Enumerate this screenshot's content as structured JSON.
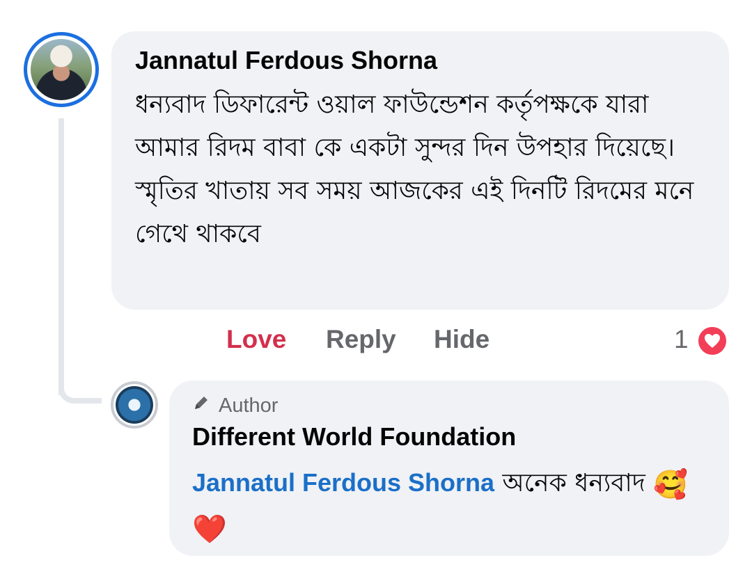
{
  "comment": {
    "author": "Jannatul Ferdous Shorna",
    "text": "ধন্যবাদ ডিফারেন্ট ওয়াল ফাউন্ডেশন কর্তৃপক্ষকে যারা আমার রিদম বাবা কে একটা সুন্দর দিন উপহার দিয়েছে। স্মৃতির খাতায় সব সময় আজকের এই দিনটি রিদমের মনে গেথে থাকবে",
    "actions": {
      "love": "Love",
      "reply": "Reply",
      "hide": "Hide"
    },
    "reaction_count": "1",
    "reaction_icon": "heart-icon",
    "colors": {
      "love_active": "#d32f4c",
      "avatar_ring": "#1b6fe0",
      "heart": "#f33e58"
    }
  },
  "reply": {
    "badge_icon": "pencil-icon",
    "badge_label": "Author",
    "author": "Different World Foundation",
    "mention": "Jannatul Ferdous Shorna",
    "text": " অনেক ধন্যবাদ ",
    "emojis": [
      "🥰",
      "❤️"
    ],
    "colors": {
      "mention": "#1b6fc8"
    }
  }
}
